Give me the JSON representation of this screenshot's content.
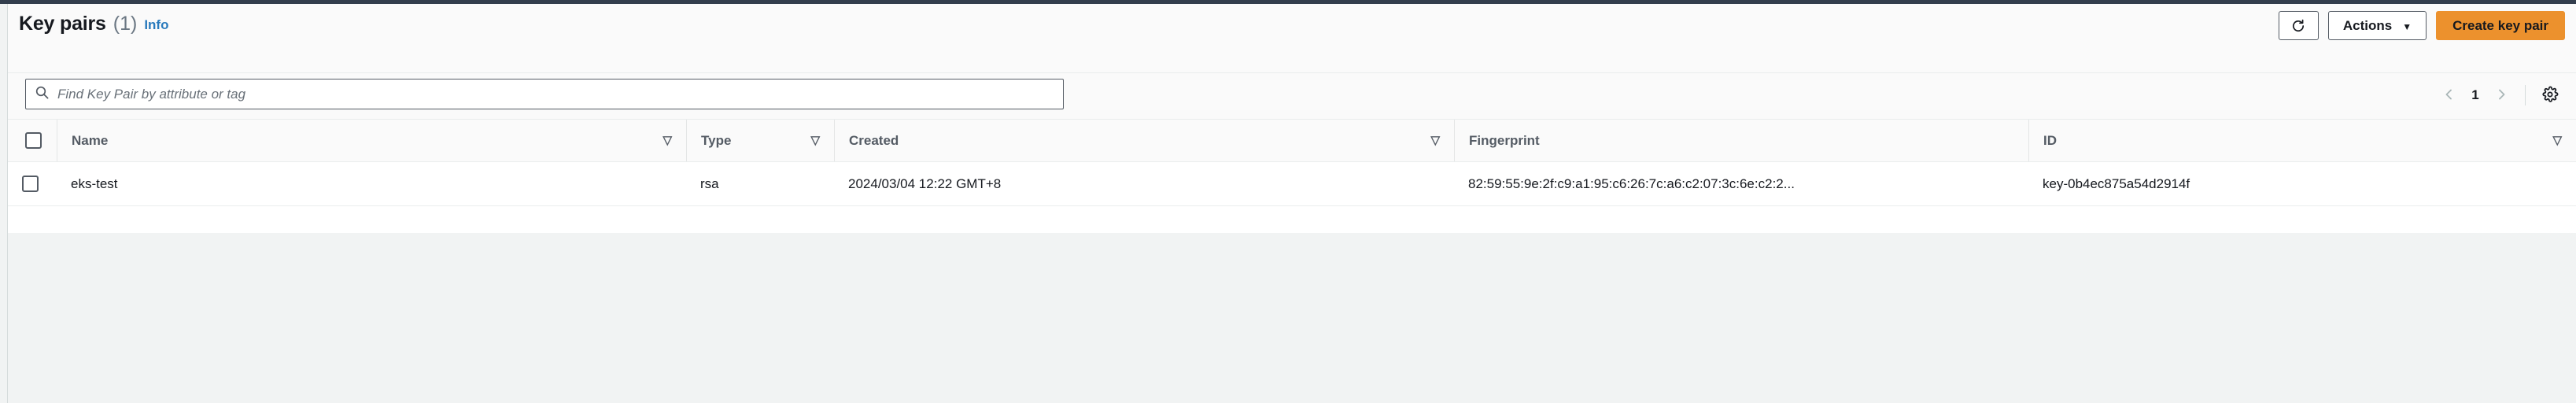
{
  "theme": {
    "accent_orange": "#ec912d",
    "link_blue": "#2a7bbd",
    "border_dark": "#545b64",
    "header_bg": "#fafafa",
    "page_bg": "#f1f3f3",
    "top_strip": "#333e4d"
  },
  "header": {
    "title": "Key pairs",
    "count": "(1)",
    "info_label": "Info",
    "refresh_icon": "refresh-icon",
    "actions_label": "Actions",
    "actions_caret": "▼",
    "create_label": "Create key pair"
  },
  "filter": {
    "search_icon": "search-icon",
    "search_value": "",
    "search_placeholder": "Find Key Pair by attribute or tag",
    "pagination": {
      "prev_icon": "chevron-left-icon",
      "page_number": "1",
      "next_icon": "chevron-right-icon"
    },
    "settings_icon": "gear-icon"
  },
  "table": {
    "select_all_checkbox": "select-all-checkbox",
    "sort_icon": "▽",
    "columns": [
      {
        "key": "name",
        "label": "Name",
        "sortable": true
      },
      {
        "key": "type",
        "label": "Type",
        "sortable": true
      },
      {
        "key": "created",
        "label": "Created",
        "sortable": true
      },
      {
        "key": "fingerprint",
        "label": "Fingerprint",
        "sortable": false
      },
      {
        "key": "id",
        "label": "ID",
        "sortable": true
      }
    ],
    "rows": [
      {
        "name": "eks-test",
        "type": "rsa",
        "created": "2024/03/04 12:22 GMT+8",
        "fingerprint": "82:59:55:9e:2f:c9:a1:95:c6:26:7c:a6:c2:07:3c:6e:c2:2...",
        "id": "key-0b4ec875a54d2914f"
      }
    ]
  }
}
